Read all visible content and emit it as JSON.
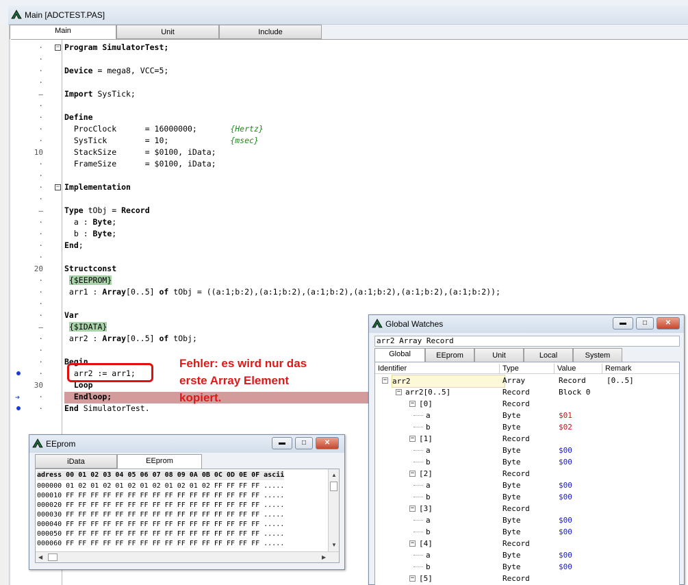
{
  "main": {
    "title": "Main [ADCTEST.PAS]",
    "tabs": [
      "Main",
      "Unit",
      "Include"
    ],
    "line_numbers": {
      "l10": "10",
      "l20": "20",
      "l30": "30"
    },
    "code": {
      "l1": "Program SimulatorTest;",
      "l3a": "Device",
      "l3b": " = mega8, VCC=5;",
      "l5a": "Import",
      "l5b": " SysTick;",
      "l7": "Define",
      "l8a": "  ProcClock      = 16000000;       ",
      "l8b": "{Hertz}",
      "l9a": "  SysTick        = 10;             ",
      "l9b": "{msec}",
      "l10": "  StackSize      = $0100, iData;",
      "l11": "  FrameSize      = $0100, iData;",
      "l13": "Implementation",
      "l15a": "Type",
      "l15b": " tObj = ",
      "l15c": "Record",
      "l16a": "  a : ",
      "l16b": "Byte",
      "l17a": "  b : ",
      "l17b": "Byte",
      "l18": "End",
      "l20": "Structconst",
      "l21": "{$EEPROM}",
      "l22a": " arr1 : ",
      "l22b": "Array",
      "l22c": "[0..5] ",
      "l22d": "of",
      "l22e": " tObj = ((a:1;b:2),(a:1;b:2),(a:1;b:2),(a:1;b:2),(a:1;b:2),(a:1;b:2));",
      "l24": "Var",
      "l25": "{$IDATA}",
      "l26a": " arr2 : ",
      "l26b": "Array",
      "l26c": "[0..5] ",
      "l26d": "of",
      "l26e": " tObj;",
      "l28": "Begin",
      "l29": "  arr2 := arr1;",
      "l30": "  Loop",
      "l31": "  Endloop;",
      "l32a": "End",
      "l32b": " SimulatorTest."
    },
    "annotation": "Fehler: es wird nur das erste Array Element kopiert."
  },
  "eeprom": {
    "title": "EEprom",
    "tabs": [
      "iData",
      "EEprom"
    ],
    "header": "adress 00 01 02 03 04 05 06 07 08 09 0A 0B 0C 0D 0E 0F ascii",
    "rows": [
      "000000 01 02 01 02 01 02 01 02 01 02 01 02 FF FF FF FF .....",
      "000010 FF FF FF FF FF FF FF FF FF FF FF FF FF FF FF FF .....",
      "000020 FF FF FF FF FF FF FF FF FF FF FF FF FF FF FF FF .....",
      "000030 FF FF FF FF FF FF FF FF FF FF FF FF FF FF FF FF .....",
      "000040 FF FF FF FF FF FF FF FF FF FF FF FF FF FF FF FF .....",
      "000050 FF FF FF FF FF FF FF FF FF FF FF FF FF FF FF FF .....",
      "000060 FF FF FF FF FF FF FF FF FF FF FF FF FF FF FF FF ....."
    ]
  },
  "watches": {
    "title": "Global Watches",
    "status": "arr2 Array Record",
    "tabs": [
      "Global",
      "EEprom",
      "Unit",
      "Local",
      "System"
    ],
    "columns": [
      "Identifier",
      "Type",
      "Value",
      "Remark"
    ],
    "rows": [
      {
        "id": "arr2",
        "type": "Array",
        "value": "Record",
        "remark": "[0..5]"
      },
      {
        "id": "arr2[0..5]",
        "type": "Record",
        "value": "Block 0",
        "remark": ""
      },
      {
        "id": "[0]",
        "type": "Record",
        "value": "",
        "remark": ""
      },
      {
        "id": "a",
        "type": "Byte",
        "value": "$01",
        "remark": ""
      },
      {
        "id": "b",
        "type": "Byte",
        "value": "$02",
        "remark": ""
      },
      {
        "id": "[1]",
        "type": "Record",
        "value": "",
        "remark": ""
      },
      {
        "id": "a",
        "type": "Byte",
        "value": "$00",
        "remark": ""
      },
      {
        "id": "b",
        "type": "Byte",
        "value": "$00",
        "remark": ""
      },
      {
        "id": "[2]",
        "type": "Record",
        "value": "",
        "remark": ""
      },
      {
        "id": "a",
        "type": "Byte",
        "value": "$00",
        "remark": ""
      },
      {
        "id": "b",
        "type": "Byte",
        "value": "$00",
        "remark": ""
      },
      {
        "id": "[3]",
        "type": "Record",
        "value": "",
        "remark": ""
      },
      {
        "id": "a",
        "type": "Byte",
        "value": "$00",
        "remark": ""
      },
      {
        "id": "b",
        "type": "Byte",
        "value": "$00",
        "remark": ""
      },
      {
        "id": "[4]",
        "type": "Record",
        "value": "",
        "remark": ""
      },
      {
        "id": "a",
        "type": "Byte",
        "value": "$00",
        "remark": ""
      },
      {
        "id": "b",
        "type": "Byte",
        "value": "$00",
        "remark": ""
      },
      {
        "id": "[5]",
        "type": "Record",
        "value": "",
        "remark": ""
      }
    ]
  },
  "colors": {
    "annotation": "#e01818",
    "changed_value": "#d01010",
    "value": "#1a1ad0",
    "exec_line": "#d39b9b",
    "directive": "#a9d4a9"
  }
}
